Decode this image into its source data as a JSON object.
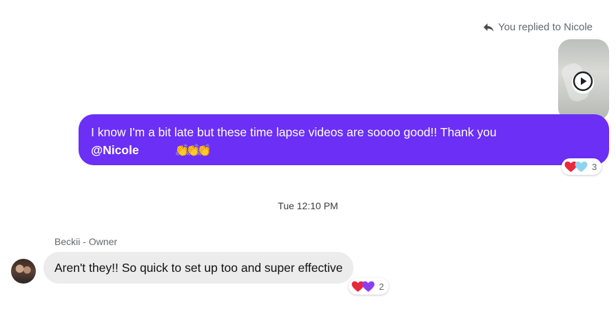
{
  "conversation": {
    "reply_note": "You replied to Nicole",
    "outgoing": {
      "text": "I know I'm a bit late but these time lapse videos are soooo good!! Thank you",
      "mention": "@Nicole",
      "emoji": "👏👏👏",
      "reactions": {
        "icons": [
          "heart-red",
          "heart-light-blue"
        ],
        "count": "3"
      }
    },
    "timestamp": "Tue 12:10 PM",
    "incoming": {
      "sender": "Beckii - Owner",
      "text": "Aren't they!! So quick to set up too and super effective",
      "reactions": {
        "icons": [
          "heart-red",
          "heart-purple"
        ],
        "count": "2"
      }
    }
  },
  "icons": {
    "reply": "reply-arrow-icon",
    "play": "play-icon"
  },
  "colors": {
    "outgoing_bubble": "#6b2ff5",
    "incoming_bubble": "#ececec",
    "heart_red": "#e8283b",
    "heart_light_blue": "#8fd3f2",
    "heart_purple": "#8e3cf0"
  }
}
